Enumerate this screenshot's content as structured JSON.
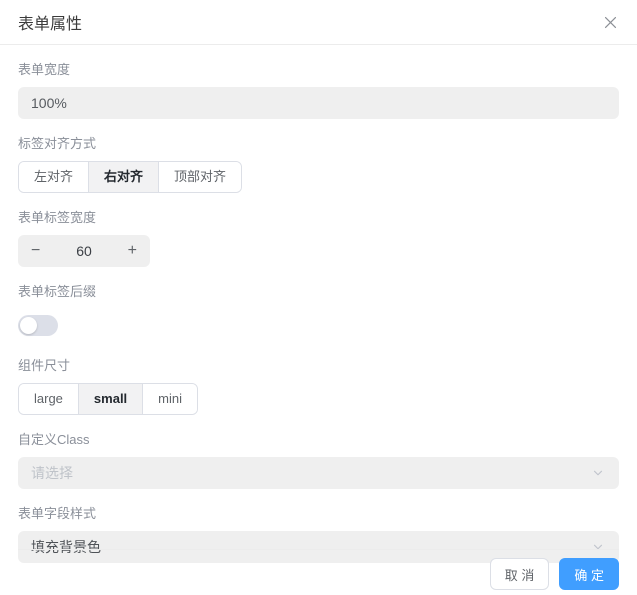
{
  "dialog": {
    "title": "表单属性"
  },
  "icons": {
    "close": "close-x",
    "chevron_down": "chevron-down",
    "minus": "−",
    "plus": "+"
  },
  "fields": {
    "form_width": {
      "label": "表单宽度",
      "value": "100%"
    },
    "label_align": {
      "label": "标签对齐方式",
      "selected": "右对齐",
      "options": [
        {
          "label": "左对齐",
          "selected": false
        },
        {
          "label": "右对齐",
          "selected": true
        },
        {
          "label": "顶部对齐",
          "selected": false
        }
      ]
    },
    "label_width": {
      "label": "表单标签宽度",
      "value": "60"
    },
    "label_suffix": {
      "label": "表单标签后缀",
      "enabled": false
    },
    "component_size": {
      "label": "组件尺寸",
      "selected": "small",
      "options": [
        {
          "label": "large",
          "selected": false
        },
        {
          "label": "small",
          "selected": true
        },
        {
          "label": "mini",
          "selected": false
        }
      ]
    },
    "custom_class": {
      "label": "自定义Class",
      "placeholder": "请选择"
    },
    "field_style": {
      "label": "表单字段样式",
      "value": "填充背景色"
    }
  },
  "footer": {
    "cancel_label": "取 消",
    "confirm_label": "确 定"
  },
  "colors": {
    "primary": "#409eff",
    "input_bg": "#efefef",
    "border": "#dcdfe6",
    "label_text": "#8a8f99",
    "toggle_off": "#dcdfe8"
  }
}
